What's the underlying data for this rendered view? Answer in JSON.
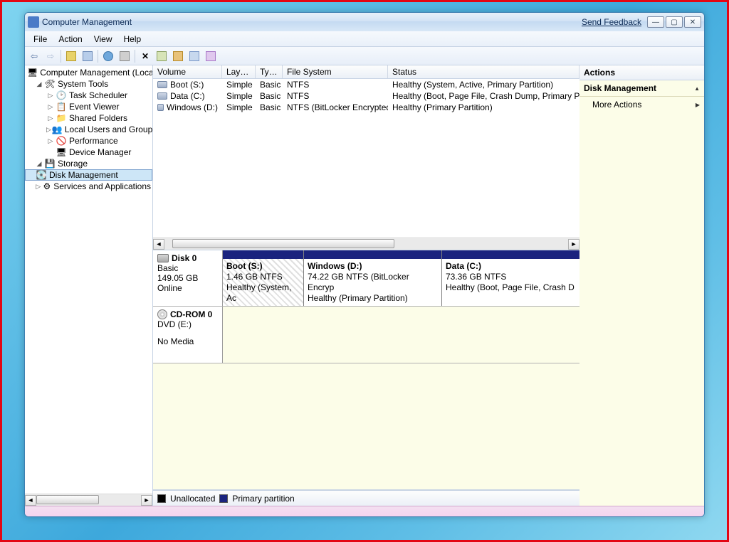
{
  "window": {
    "title": "Computer Management",
    "feedback": "Send Feedback"
  },
  "menus": [
    "File",
    "Action",
    "View",
    "Help"
  ],
  "tree": {
    "root": "Computer Management (Local",
    "systools": "System Tools",
    "items_st": [
      "Task Scheduler",
      "Event Viewer",
      "Shared Folders",
      "Local Users and Groups",
      "Performance",
      "Device Manager"
    ],
    "storage": "Storage",
    "diskmgmt": "Disk Management",
    "services": "Services and Applications"
  },
  "volcols": {
    "v": "Volume",
    "l": "Layout",
    "t": "Type",
    "f": "File System",
    "s": "Status"
  },
  "volumes": [
    {
      "name": "Boot (S:)",
      "layout": "Simple",
      "type": "Basic",
      "fs": "NTFS",
      "status": "Healthy (System, Active, Primary Partition)"
    },
    {
      "name": "Data (C:)",
      "layout": "Simple",
      "type": "Basic",
      "fs": "NTFS",
      "status": "Healthy (Boot, Page File, Crash Dump, Primary P"
    },
    {
      "name": "Windows (D:)",
      "layout": "Simple",
      "type": "Basic",
      "fs": "NTFS (BitLocker Encrypted)",
      "status": "Healthy (Primary Partition)"
    }
  ],
  "disk0": {
    "name": "Disk 0",
    "type": "Basic",
    "size": "149.05 GB",
    "status": "Online",
    "p1": {
      "title": "Boot  (S:)",
      "line": "1.46 GB NTFS",
      "status": "Healthy (System, Ac"
    },
    "p2": {
      "title": "Windows  (D:)",
      "line": "74.22 GB NTFS (BitLocker Encryp",
      "status": "Healthy (Primary Partition)"
    },
    "p3": {
      "title": "Data  (C:)",
      "line": "73.36 GB NTFS",
      "status": "Healthy (Boot, Page File, Crash D"
    }
  },
  "cdrom": {
    "name": "CD-ROM 0",
    "type": "DVD (E:)",
    "status": "No Media"
  },
  "legend": {
    "unalloc": "Unallocated",
    "primary": "Primary partition"
  },
  "actions": {
    "head": "Actions",
    "group": "Disk Management",
    "more": "More Actions"
  }
}
